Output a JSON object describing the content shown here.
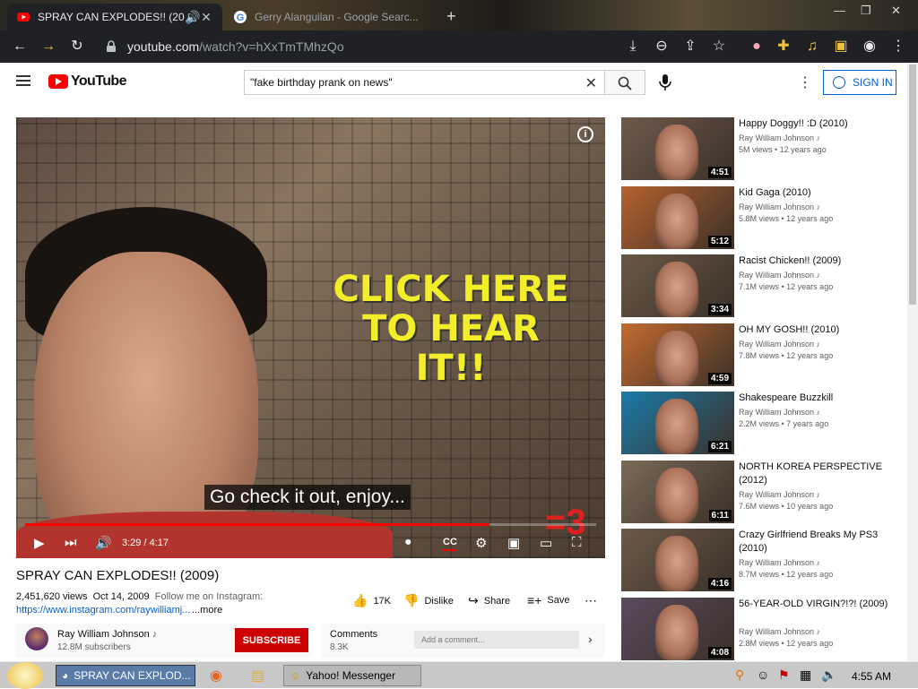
{
  "browser": {
    "tabs": [
      {
        "title": "SPRAY CAN EXPLODES!! (20...",
        "active": true
      },
      {
        "title": "Gerry Alanguilan - Google Searc...",
        "active": false
      }
    ],
    "url_host": "youtube.com",
    "url_path": "/watch?v=hXxTmTMhzQo"
  },
  "youtube": {
    "logo_text": "YouTube",
    "search_value": "\"fake birthday prank on news\"",
    "sign_in_label": "SIGN IN"
  },
  "player": {
    "overlay_text": "CLICK HERE TO HEAR IT!!",
    "caption": "Go check it out, enjoy...",
    "time": "3:29 / 4:17",
    "progress": 0.813,
    "watermark": "=3"
  },
  "video": {
    "title": "SPRAY CAN EXPLODES!! (2009)",
    "views": "2,451,620 views",
    "date": "Oct 14, 2009",
    "desc_intro": "Follow me on Instagram:",
    "desc_link": "https://www.instagram.com/raywilliamj...",
    "more_label": "...more",
    "likes": "17K",
    "dislike_label": "Dislike",
    "share_label": "Share",
    "save_label": "Save"
  },
  "channel": {
    "name": "Ray William Johnson",
    "subs": "12.8M subscribers",
    "subscribe_label": "SUBSCRIBE"
  },
  "comments": {
    "label": "Comments",
    "count": "8.3K",
    "placeholder": "Add a comment..."
  },
  "recommendations": [
    {
      "title": "Happy Doggy!! :D (2010)",
      "channel": "Ray William Johnson",
      "stats": "5M views • 12 years ago",
      "duration": "4:51",
      "bg": "#6e5a4c"
    },
    {
      "title": "Kid Gaga (2010)",
      "channel": "Ray William Johnson",
      "stats": "5.8M views • 12 years ago",
      "duration": "5:12",
      "bg": "#b6622e"
    },
    {
      "title": "Racist Chicken!! (2009)",
      "channel": "Ray William Johnson",
      "stats": "7.1M views • 12 years ago",
      "duration": "3:34",
      "bg": "#6a5846"
    },
    {
      "title": "OH MY GOSH!! (2010)",
      "channel": "Ray William Johnson",
      "stats": "7.8M views • 12 years ago",
      "duration": "4:59",
      "bg": "#c46a30"
    },
    {
      "title": "Shakespeare Buzzkill",
      "channel": "Ray William Johnson",
      "stats": "2.2M views • 7 years ago",
      "duration": "6:21",
      "bg": "#1a7aa8"
    },
    {
      "title": "NORTH KOREA PERSPECTIVE (2012)",
      "channel": "Ray William Johnson",
      "stats": "7.6M views • 10 years ago",
      "duration": "6:11",
      "bg": "#7a6a58"
    },
    {
      "title": "Crazy Girlfriend Breaks My PS3 (2010)",
      "channel": "Ray William Johnson",
      "stats": "8.7M views • 12 years ago",
      "duration": "4:16",
      "bg": "#6c5a4a"
    },
    {
      "title": "56-YEAR-OLD VIRGIN?!?! (2009)",
      "channel": "Ray William Johnson",
      "stats": "2.8M views • 12 years ago",
      "duration": "4:08",
      "bg": "#5a4a5e"
    }
  ],
  "taskbar": {
    "items": [
      "SPRAY CAN EXPLOD...",
      "Yahoo! Messenger"
    ],
    "clock": "4:55 AM"
  }
}
